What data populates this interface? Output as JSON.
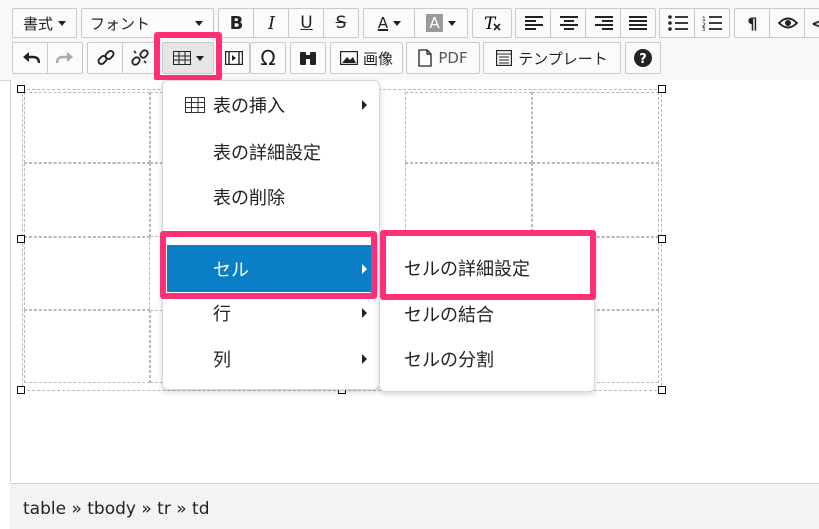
{
  "toolbar": {
    "format_label": "書式",
    "font_label": "フォント",
    "image_label": "画像",
    "pdf_label": "PDF",
    "template_label": "テンプレート"
  },
  "table_menu": {
    "items": [
      {
        "label": "表の挿入"
      },
      {
        "label": "表の詳細設定"
      },
      {
        "label": "表の削除"
      },
      {
        "label": "セル"
      },
      {
        "label": "行"
      },
      {
        "label": "列"
      }
    ]
  },
  "cell_submenu": {
    "items": [
      {
        "label": "セルの詳細設定"
      },
      {
        "label": "セルの結合"
      },
      {
        "label": "セルの分割"
      }
    ]
  },
  "statusbar": {
    "path": "table » tbody » tr » td"
  },
  "colors": {
    "accent": "#0a7fc7",
    "highlight": "#ff2f7a"
  }
}
